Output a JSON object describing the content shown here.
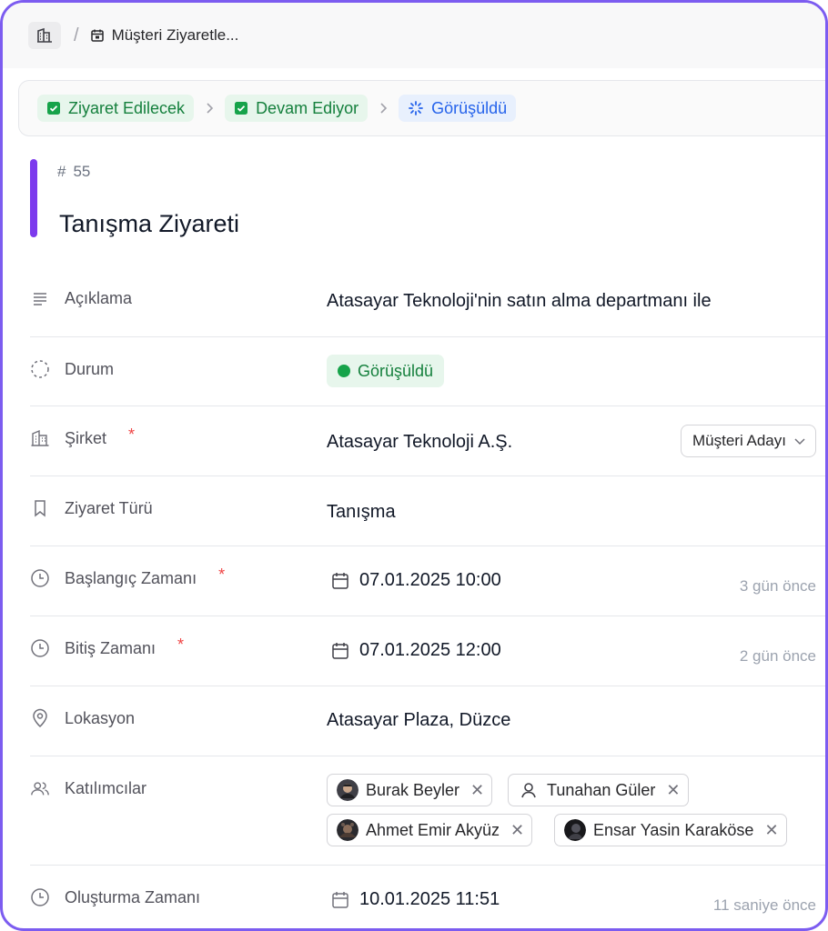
{
  "breadcrumb": {
    "home_icon": "building-icon",
    "separator": "/",
    "current": "Müşteri Ziyaretle..."
  },
  "stages": [
    {
      "label": "Ziyaret Edilecek",
      "state": "done"
    },
    {
      "label": "Devam Ediyor",
      "state": "done"
    },
    {
      "label": "Görüşüldü",
      "state": "current"
    }
  ],
  "record": {
    "id_prefix": "#",
    "id": "55",
    "title": "Tanışma Ziyareti"
  },
  "fields": {
    "description": {
      "label": "Açıklama",
      "value": "Atasayar Teknoloji'nin satın alma departmanı ile"
    },
    "status": {
      "label": "Durum",
      "value": "Görüşüldü"
    },
    "company": {
      "label": "Şirket",
      "required": "*",
      "value": "Atasayar Teknoloji A.Ş.",
      "type_select": "Müşteri Adayı"
    },
    "visit_type": {
      "label": "Ziyaret Türü",
      "value": "Tanışma"
    },
    "start_time": {
      "label": "Başlangıç Zamanı",
      "required": "*",
      "value": "07.01.2025 10:00",
      "relative": "3 gün önce"
    },
    "end_time": {
      "label": "Bitiş Zamanı",
      "required": "*",
      "value": "07.01.2025 12:00",
      "relative": "2 gün önce"
    },
    "location": {
      "label": "Lokasyon",
      "value": "Atasayar Plaza, Düzce"
    },
    "participants": {
      "label": "Katılımcılar",
      "people": [
        {
          "name": "Burak Beyler",
          "avatar": "photo"
        },
        {
          "name": "Tunahan Güler",
          "avatar": "user-icon"
        },
        {
          "name": "Ahmet Emir Akyüz",
          "avatar": "photo"
        },
        {
          "name": "Ensar Yasin Karaköse",
          "avatar": "photo"
        }
      ],
      "remove_glyph": "✕"
    },
    "created_at": {
      "label": "Oluşturma Zamanı",
      "value": "10.01.2025 11:51",
      "relative": "11 saniye önce"
    }
  },
  "colors": {
    "accent": "#7c3aed",
    "frame": "#7c5cf0",
    "done_bg": "#e7f6ec",
    "done_text": "#15803d",
    "current_bg": "#e8f0fd",
    "current_text": "#2563eb",
    "required": "#ef4444"
  }
}
